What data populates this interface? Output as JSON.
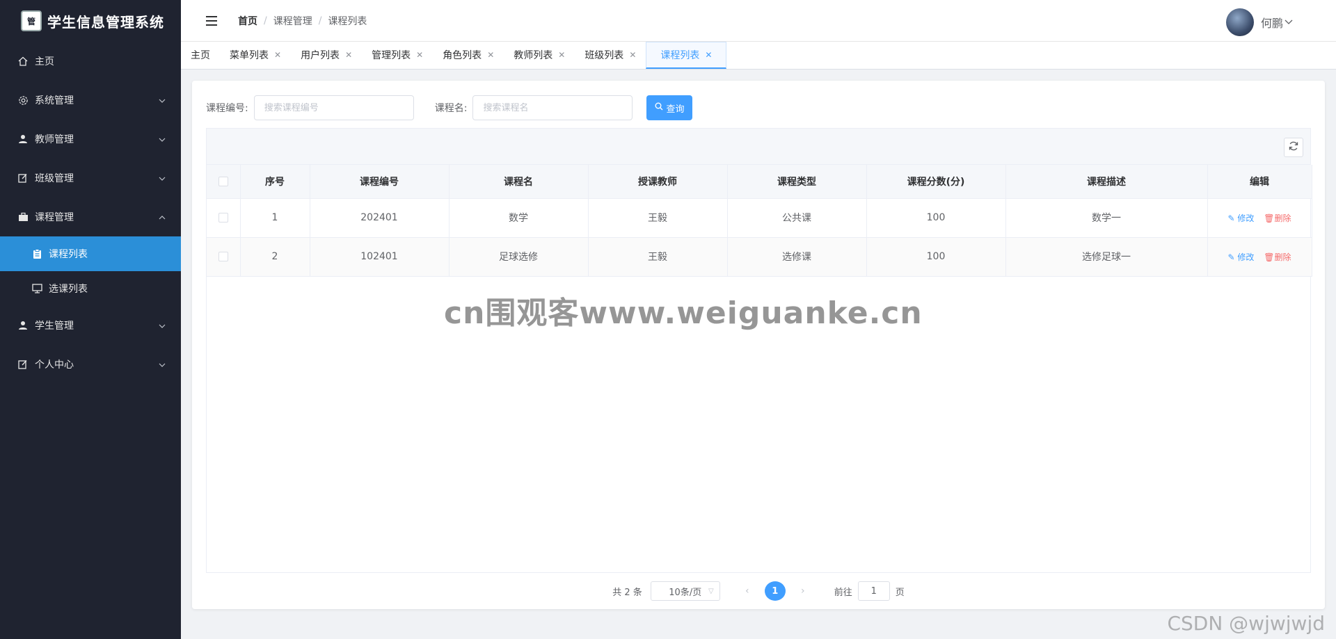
{
  "app": {
    "title": "学生信息管理系统",
    "logo_text": "管"
  },
  "sidebar": {
    "items": [
      {
        "label": "主页",
        "icon": "home-icon"
      },
      {
        "label": "系统管理",
        "icon": "gear-icon"
      },
      {
        "label": "教师管理",
        "icon": "user-icon"
      },
      {
        "label": "班级管理",
        "icon": "edit-icon"
      },
      {
        "label": "课程管理",
        "icon": "briefcase-icon"
      },
      {
        "label": "学生管理",
        "icon": "user-icon"
      },
      {
        "label": "个人中心",
        "icon": "edit-icon"
      }
    ],
    "sub_items": [
      {
        "label": "课程列表",
        "icon": "clipboard-icon"
      },
      {
        "label": "选课列表",
        "icon": "monitor-icon"
      }
    ]
  },
  "header": {
    "breadcrumb": [
      "首页",
      "课程管理",
      "课程列表"
    ],
    "user_name": "何鹏"
  },
  "tabs": [
    {
      "label": "主页"
    },
    {
      "label": "菜单列表"
    },
    {
      "label": "用户列表"
    },
    {
      "label": "管理列表"
    },
    {
      "label": "角色列表"
    },
    {
      "label": "教师列表"
    },
    {
      "label": "班级列表"
    },
    {
      "label": "课程列表"
    }
  ],
  "search": {
    "code_label": "课程编号:",
    "code_placeholder": "搜索课程编号",
    "name_label": "课程名:",
    "name_placeholder": "搜索课程名",
    "button_label": "查询"
  },
  "table": {
    "headers": [
      "序号",
      "课程编号",
      "课程名",
      "授课教师",
      "课程类型",
      "课程分数(分)",
      "课程描述",
      "编辑"
    ],
    "rows": [
      {
        "index": "1",
        "code": "202401",
        "name": "数学",
        "teacher": "王毅",
        "type": "公共课",
        "score": "100",
        "desc": "数学一"
      },
      {
        "index": "2",
        "code": "102401",
        "name": "足球选修",
        "teacher": "王毅",
        "type": "选修课",
        "score": "100",
        "desc": "选修足球一"
      }
    ],
    "edit_label": "修改",
    "delete_label": "删除"
  },
  "pagination": {
    "total": "共 2 条",
    "page_size": "10条/页",
    "current_page": "1",
    "jump_prefix": "前往",
    "jump_value": "1",
    "jump_suffix": "页"
  },
  "watermarks": {
    "center": "cn围观客www.weiguanke.cn",
    "corner": "CSDN @wjwjwjd"
  },
  "colors": {
    "sidebar_bg": "#1f2330",
    "active_menu": "#2b8fd8",
    "primary": "#409eff",
    "danger": "#f56c6c"
  }
}
